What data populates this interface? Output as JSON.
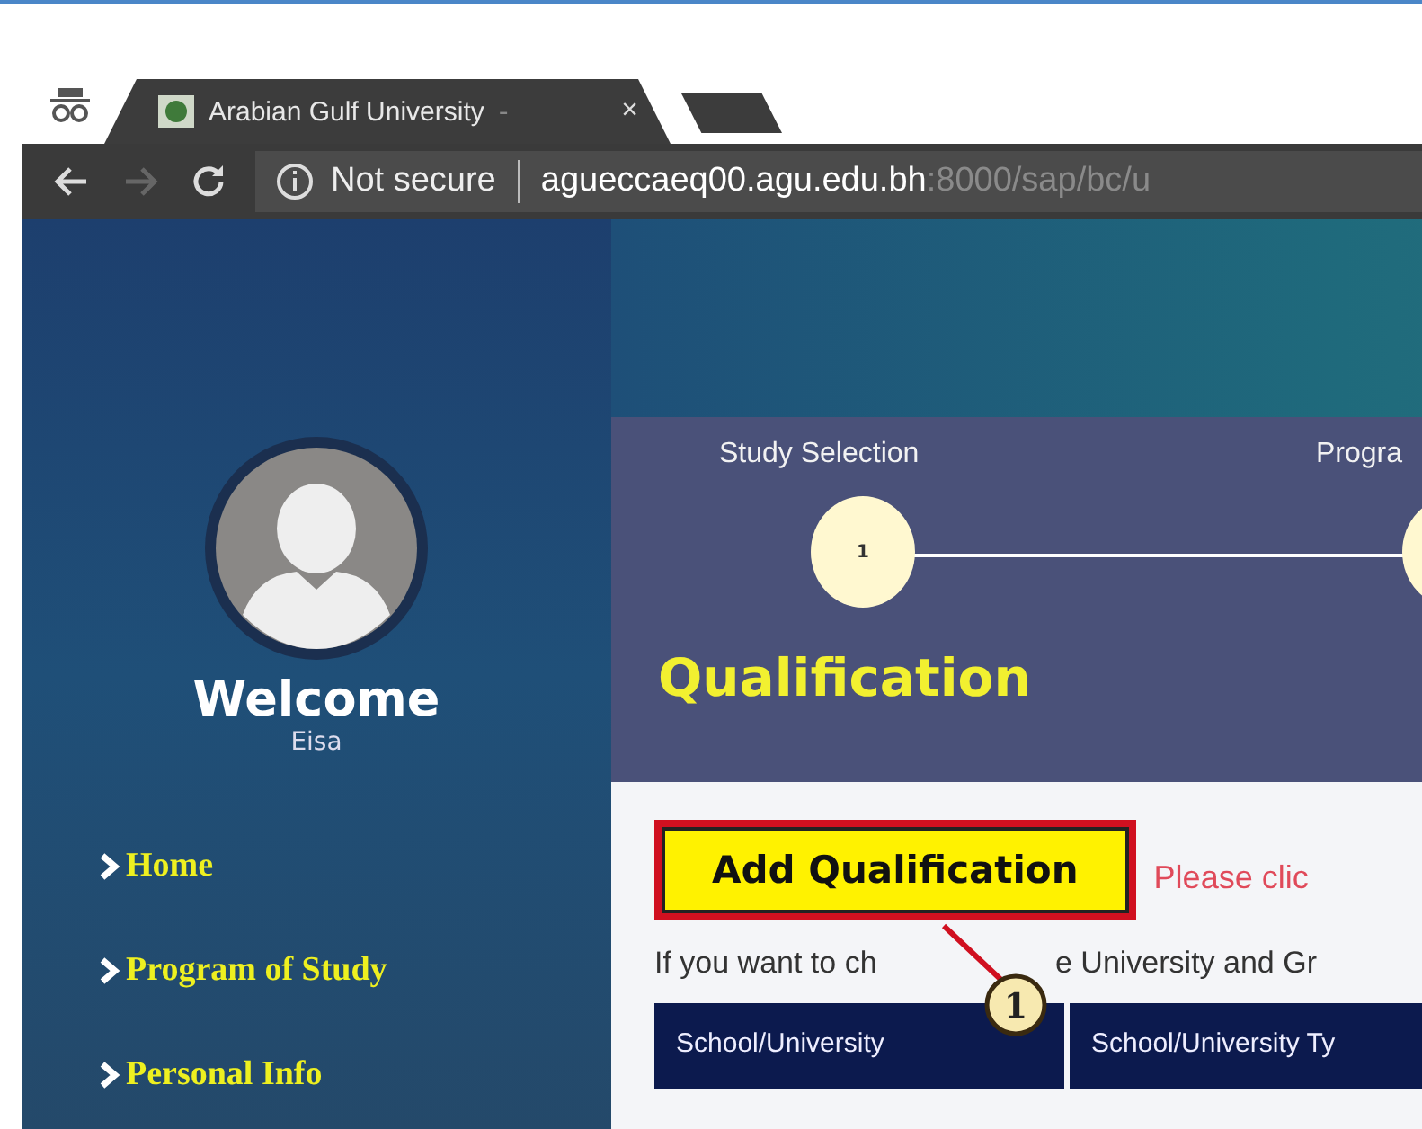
{
  "browser": {
    "tab": {
      "title": "Arabian Gulf University",
      "separator": "-",
      "close": "×"
    },
    "address": {
      "security": "Not secure",
      "host": "agueccaeq00.agu.edu.bh",
      "path": ":8000/sap/bc/u"
    }
  },
  "sidebar": {
    "welcome": "Welcome",
    "user": "Eisa",
    "items": [
      {
        "label": "Home"
      },
      {
        "label": "Program of Study"
      },
      {
        "label": "Personal Info"
      }
    ]
  },
  "steps": [
    {
      "label": "Study Selection",
      "number": "1"
    },
    {
      "label": "Progra"
    }
  ],
  "heading": "Qualification",
  "add_button": "Add Qualification",
  "hint": "Please clic",
  "note_before": "If you want to ch",
  "note_after": "e University and Gr",
  "callout": "1",
  "table": {
    "columns": [
      "School/University",
      "School/University Ty"
    ]
  }
}
